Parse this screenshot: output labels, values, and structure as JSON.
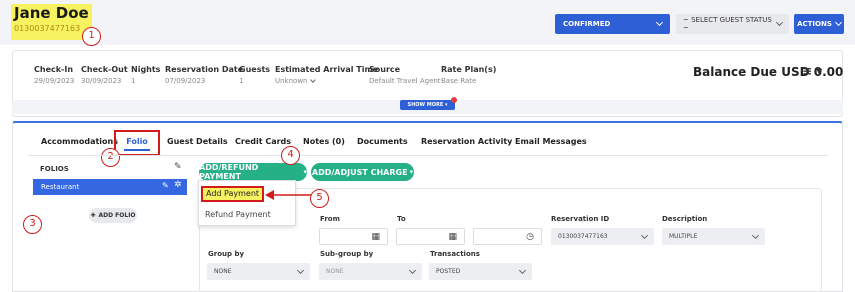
{
  "header": {
    "guest_name": "Jane Doe",
    "reservation_id": "0130037477163",
    "status_button": "CONFIRMED",
    "guest_status_select": "~ SELECT GUEST STATUS ~",
    "actions_button": "ACTIONS"
  },
  "summary": {
    "fields": [
      {
        "label": "Check-In",
        "value": "29/09/2023"
      },
      {
        "label": "Check-Out",
        "value": "30/09/2023"
      },
      {
        "label": "Nights",
        "value": "1"
      },
      {
        "label": "Reservation Date",
        "value": "07/09/2023"
      },
      {
        "label": "Guests",
        "value": "1"
      },
      {
        "label": "Estimated Arrival Time",
        "value": "Unknown"
      },
      {
        "label": "Source",
        "value": "Default Travel Agent"
      },
      {
        "label": "Rate Plan(s)",
        "value": "Base Rate"
      }
    ],
    "balance_due": "Balance Due USD 0.00",
    "show_more": "SHOW MORE"
  },
  "tabs": [
    {
      "label": "Accommodations"
    },
    {
      "label": "Folio"
    },
    {
      "label": "Guest Details"
    },
    {
      "label": "Credit Cards"
    },
    {
      "label": "Notes (0)"
    },
    {
      "label": "Documents"
    },
    {
      "label": "Reservation Activity"
    },
    {
      "label": "Email Messages"
    }
  ],
  "folios": {
    "heading": "FOLIOS",
    "items": [
      "Restaurant"
    ],
    "add_label": "ADD FOLIO"
  },
  "actions": {
    "add_refund": "ADD/REFUND PAYMENT",
    "add_adjust": "ADD/ADJUST CHARGE"
  },
  "dropdown": {
    "items": [
      "Add Payment",
      "Refund Payment"
    ]
  },
  "filters": {
    "from_label": "From",
    "to_label": "To",
    "reservation_id_label": "Reservation ID",
    "reservation_id_value": "0130037477163",
    "description_label": "Description",
    "description_value": "MULTIPLE",
    "group_by_label": "Group by",
    "group_by_value": "NONE",
    "subgroup_label": "Sub-group by",
    "subgroup_value": "NONE",
    "transactions_label": "Transactions",
    "transactions_value": "POSTED"
  },
  "callouts": [
    "1",
    "2",
    "3",
    "4",
    "5"
  ],
  "colors": {
    "primary": "#2f5fd7",
    "green": "#25b086",
    "highlight": "#f6f260",
    "annotation": "#d21c1c"
  }
}
